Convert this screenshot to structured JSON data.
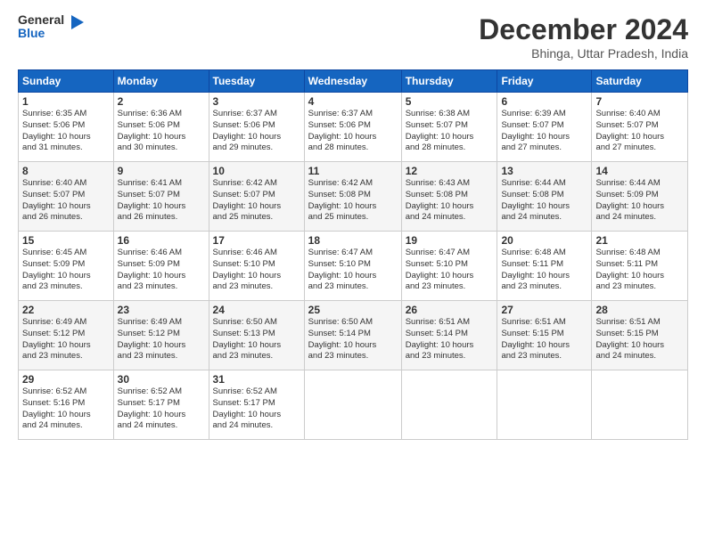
{
  "logo": {
    "line1": "General",
    "line2": "Blue"
  },
  "header": {
    "month": "December 2024",
    "location": "Bhinga, Uttar Pradesh, India"
  },
  "days_of_week": [
    "Sunday",
    "Monday",
    "Tuesday",
    "Wednesday",
    "Thursday",
    "Friday",
    "Saturday"
  ],
  "weeks": [
    [
      {
        "day": "1",
        "info": "Sunrise: 6:35 AM\nSunset: 5:06 PM\nDaylight: 10 hours\nand 31 minutes."
      },
      {
        "day": "2",
        "info": "Sunrise: 6:36 AM\nSunset: 5:06 PM\nDaylight: 10 hours\nand 30 minutes."
      },
      {
        "day": "3",
        "info": "Sunrise: 6:37 AM\nSunset: 5:06 PM\nDaylight: 10 hours\nand 29 minutes."
      },
      {
        "day": "4",
        "info": "Sunrise: 6:37 AM\nSunset: 5:06 PM\nDaylight: 10 hours\nand 28 minutes."
      },
      {
        "day": "5",
        "info": "Sunrise: 6:38 AM\nSunset: 5:07 PM\nDaylight: 10 hours\nand 28 minutes."
      },
      {
        "day": "6",
        "info": "Sunrise: 6:39 AM\nSunset: 5:07 PM\nDaylight: 10 hours\nand 27 minutes."
      },
      {
        "day": "7",
        "info": "Sunrise: 6:40 AM\nSunset: 5:07 PM\nDaylight: 10 hours\nand 27 minutes."
      }
    ],
    [
      {
        "day": "8",
        "info": "Sunrise: 6:40 AM\nSunset: 5:07 PM\nDaylight: 10 hours\nand 26 minutes."
      },
      {
        "day": "9",
        "info": "Sunrise: 6:41 AM\nSunset: 5:07 PM\nDaylight: 10 hours\nand 26 minutes."
      },
      {
        "day": "10",
        "info": "Sunrise: 6:42 AM\nSunset: 5:07 PM\nDaylight: 10 hours\nand 25 minutes."
      },
      {
        "day": "11",
        "info": "Sunrise: 6:42 AM\nSunset: 5:08 PM\nDaylight: 10 hours\nand 25 minutes."
      },
      {
        "day": "12",
        "info": "Sunrise: 6:43 AM\nSunset: 5:08 PM\nDaylight: 10 hours\nand 24 minutes."
      },
      {
        "day": "13",
        "info": "Sunrise: 6:44 AM\nSunset: 5:08 PM\nDaylight: 10 hours\nand 24 minutes."
      },
      {
        "day": "14",
        "info": "Sunrise: 6:44 AM\nSunset: 5:09 PM\nDaylight: 10 hours\nand 24 minutes."
      }
    ],
    [
      {
        "day": "15",
        "info": "Sunrise: 6:45 AM\nSunset: 5:09 PM\nDaylight: 10 hours\nand 23 minutes."
      },
      {
        "day": "16",
        "info": "Sunrise: 6:46 AM\nSunset: 5:09 PM\nDaylight: 10 hours\nand 23 minutes."
      },
      {
        "day": "17",
        "info": "Sunrise: 6:46 AM\nSunset: 5:10 PM\nDaylight: 10 hours\nand 23 minutes."
      },
      {
        "day": "18",
        "info": "Sunrise: 6:47 AM\nSunset: 5:10 PM\nDaylight: 10 hours\nand 23 minutes."
      },
      {
        "day": "19",
        "info": "Sunrise: 6:47 AM\nSunset: 5:10 PM\nDaylight: 10 hours\nand 23 minutes."
      },
      {
        "day": "20",
        "info": "Sunrise: 6:48 AM\nSunset: 5:11 PM\nDaylight: 10 hours\nand 23 minutes."
      },
      {
        "day": "21",
        "info": "Sunrise: 6:48 AM\nSunset: 5:11 PM\nDaylight: 10 hours\nand 23 minutes."
      }
    ],
    [
      {
        "day": "22",
        "info": "Sunrise: 6:49 AM\nSunset: 5:12 PM\nDaylight: 10 hours\nand 23 minutes."
      },
      {
        "day": "23",
        "info": "Sunrise: 6:49 AM\nSunset: 5:12 PM\nDaylight: 10 hours\nand 23 minutes."
      },
      {
        "day": "24",
        "info": "Sunrise: 6:50 AM\nSunset: 5:13 PM\nDaylight: 10 hours\nand 23 minutes."
      },
      {
        "day": "25",
        "info": "Sunrise: 6:50 AM\nSunset: 5:14 PM\nDaylight: 10 hours\nand 23 minutes."
      },
      {
        "day": "26",
        "info": "Sunrise: 6:51 AM\nSunset: 5:14 PM\nDaylight: 10 hours\nand 23 minutes."
      },
      {
        "day": "27",
        "info": "Sunrise: 6:51 AM\nSunset: 5:15 PM\nDaylight: 10 hours\nand 23 minutes."
      },
      {
        "day": "28",
        "info": "Sunrise: 6:51 AM\nSunset: 5:15 PM\nDaylight: 10 hours\nand 24 minutes."
      }
    ],
    [
      {
        "day": "29",
        "info": "Sunrise: 6:52 AM\nSunset: 5:16 PM\nDaylight: 10 hours\nand 24 minutes."
      },
      {
        "day": "30",
        "info": "Sunrise: 6:52 AM\nSunset: 5:17 PM\nDaylight: 10 hours\nand 24 minutes."
      },
      {
        "day": "31",
        "info": "Sunrise: 6:52 AM\nSunset: 5:17 PM\nDaylight: 10 hours\nand 24 minutes."
      },
      null,
      null,
      null,
      null
    ]
  ]
}
